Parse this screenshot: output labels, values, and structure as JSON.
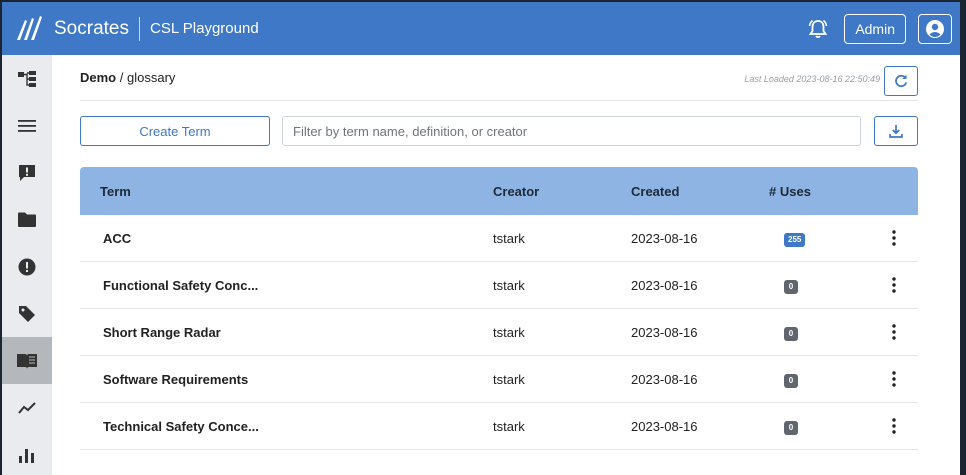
{
  "header": {
    "app_name": "Socrates",
    "project_name": "CSL Playground",
    "admin_label": "Admin",
    "icons": [
      "logo-icon",
      "bell-icon",
      "user-circle-icon"
    ],
    "brand_color": "#3f78c6"
  },
  "sidebar": {
    "items": [
      {
        "name": "hierarchy-icon",
        "active": false
      },
      {
        "name": "menu-icon",
        "active": false
      },
      {
        "name": "comment-alert-icon",
        "active": false
      },
      {
        "name": "folder-icon",
        "active": false
      },
      {
        "name": "alert-circle-icon",
        "active": false
      },
      {
        "name": "tag-icon",
        "active": false
      },
      {
        "name": "book-icon",
        "active": true
      },
      {
        "name": "trend-icon",
        "active": false
      },
      {
        "name": "bar-chart-icon",
        "active": false
      }
    ]
  },
  "breadcrumb": {
    "root": "Demo",
    "separator": "/",
    "current": "glossary"
  },
  "last_loaded": "Last Loaded 2023-08-16 22:50:49",
  "toolbar": {
    "create_label": "Create Term",
    "filter_placeholder": "Filter by term name, definition, or creator"
  },
  "table": {
    "headers": {
      "term": "Term",
      "creator": "Creator",
      "created": "Created",
      "uses": "# Uses"
    },
    "rows": [
      {
        "term": "ACC",
        "creator": "tstark",
        "created": "2023-08-16",
        "uses": "255",
        "badge": "primary"
      },
      {
        "term": "Functional Safety Conc...",
        "creator": "tstark",
        "created": "2023-08-16",
        "uses": "0",
        "badge": "secondary"
      },
      {
        "term": "Short Range Radar",
        "creator": "tstark",
        "created": "2023-08-16",
        "uses": "0",
        "badge": "secondary"
      },
      {
        "term": "Software Requirements",
        "creator": "tstark",
        "created": "2023-08-16",
        "uses": "0",
        "badge": "secondary"
      },
      {
        "term": "Technical Safety Conce...",
        "creator": "tstark",
        "created": "2023-08-16",
        "uses": "0",
        "badge": "secondary"
      }
    ]
  }
}
